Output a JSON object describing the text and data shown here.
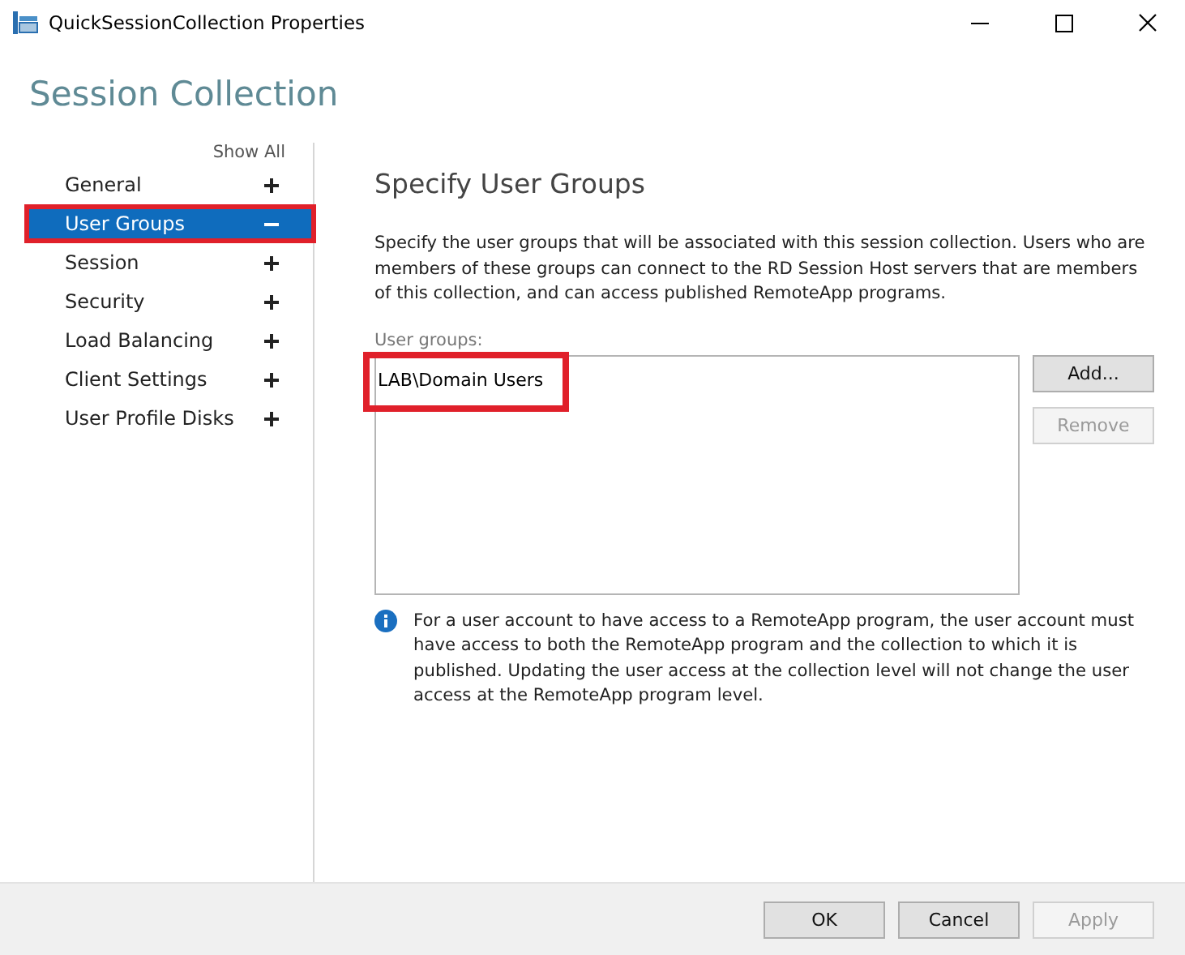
{
  "window": {
    "title": "QuickSessionCollection Properties"
  },
  "heading": "Session Collection",
  "sidebar": {
    "show_all": "Show All",
    "items": [
      {
        "label": "General",
        "expanded": false,
        "selected": false,
        "highlighted": false
      },
      {
        "label": "User Groups",
        "expanded": true,
        "selected": true,
        "highlighted": true
      },
      {
        "label": "Session",
        "expanded": false,
        "selected": false,
        "highlighted": false
      },
      {
        "label": "Security",
        "expanded": false,
        "selected": false,
        "highlighted": false
      },
      {
        "label": "Load Balancing",
        "expanded": false,
        "selected": false,
        "highlighted": false
      },
      {
        "label": "Client Settings",
        "expanded": false,
        "selected": false,
        "highlighted": false
      },
      {
        "label": "User Profile Disks",
        "expanded": false,
        "selected": false,
        "highlighted": false
      }
    ]
  },
  "section_title": "Specify User Groups",
  "description": "Specify the user groups that will be associated with this session collection. Users who are members of these groups can connect to the RD Session Host servers that are members of this collection, and can access published RemoteApp programs.",
  "groups_label": "User groups:",
  "groups": [
    {
      "name": "LAB\\Domain Users",
      "highlighted": true
    }
  ],
  "side_buttons": [
    {
      "label": "Add...",
      "disabled": false
    },
    {
      "label": "Remove",
      "disabled": true
    }
  ],
  "info": "For a user account to have access to a RemoteApp program, the user account must have access to both the RemoteApp program and the collection to which it is published. Updating the user access at the collection level will not change the user access at the RemoteApp program level.",
  "footer_buttons": [
    {
      "label": "OK",
      "disabled": false
    },
    {
      "label": "Cancel",
      "disabled": false
    },
    {
      "label": "Apply",
      "disabled": true
    }
  ]
}
